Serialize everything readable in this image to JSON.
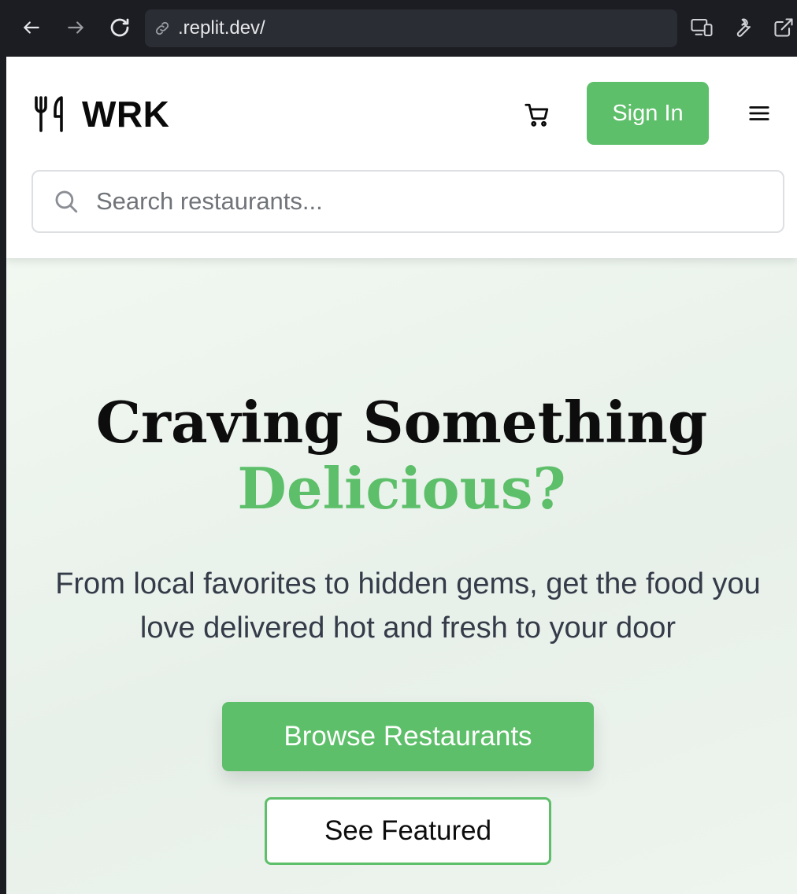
{
  "browser": {
    "url": ".replit.dev/",
    "icons": {
      "back": "arrow-left-icon",
      "forward": "arrow-right-icon",
      "reload": "reload-icon",
      "link": "link-icon",
      "devices": "devices-icon",
      "wrench": "wrench-icon",
      "external": "external-link-icon"
    }
  },
  "header": {
    "logo_text": "WRK",
    "logo_icon": "utensils-icon",
    "cart_icon": "cart-icon",
    "signin_label": "Sign In",
    "menu_icon": "hamburger-icon"
  },
  "search": {
    "placeholder": "Search restaurants...",
    "value": ""
  },
  "hero": {
    "title_line1": "Craving Something",
    "title_line2": "Delicious?",
    "subtitle": "From local favorites to hidden gems, get the food you love delivered hot and fresh to your door",
    "primary_button": "Browse Restaurants",
    "secondary_button": "See Featured"
  },
  "colors": {
    "accent": "#5dbf69",
    "chrome_bg": "#1b1d22",
    "hero_bg": "#eef5ee",
    "text_dark": "#0d0d0d",
    "text_body": "#353b48"
  }
}
